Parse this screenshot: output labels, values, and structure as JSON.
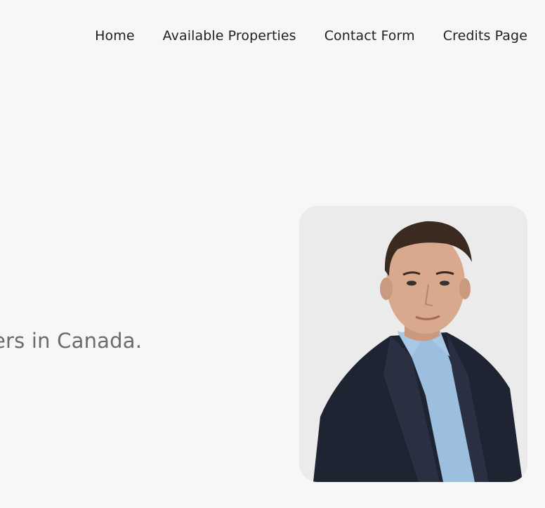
{
  "nav": {
    "items": [
      {
        "label": "Home"
      },
      {
        "label": "Available Properties"
      },
      {
        "label": "Contact Form"
      },
      {
        "label": "Credits Page"
      }
    ]
  },
  "hero": {
    "text_fragment": "ers in Canada."
  },
  "portrait": {
    "alt": "Portrait of a man in a dark blazer and light blue shirt"
  }
}
